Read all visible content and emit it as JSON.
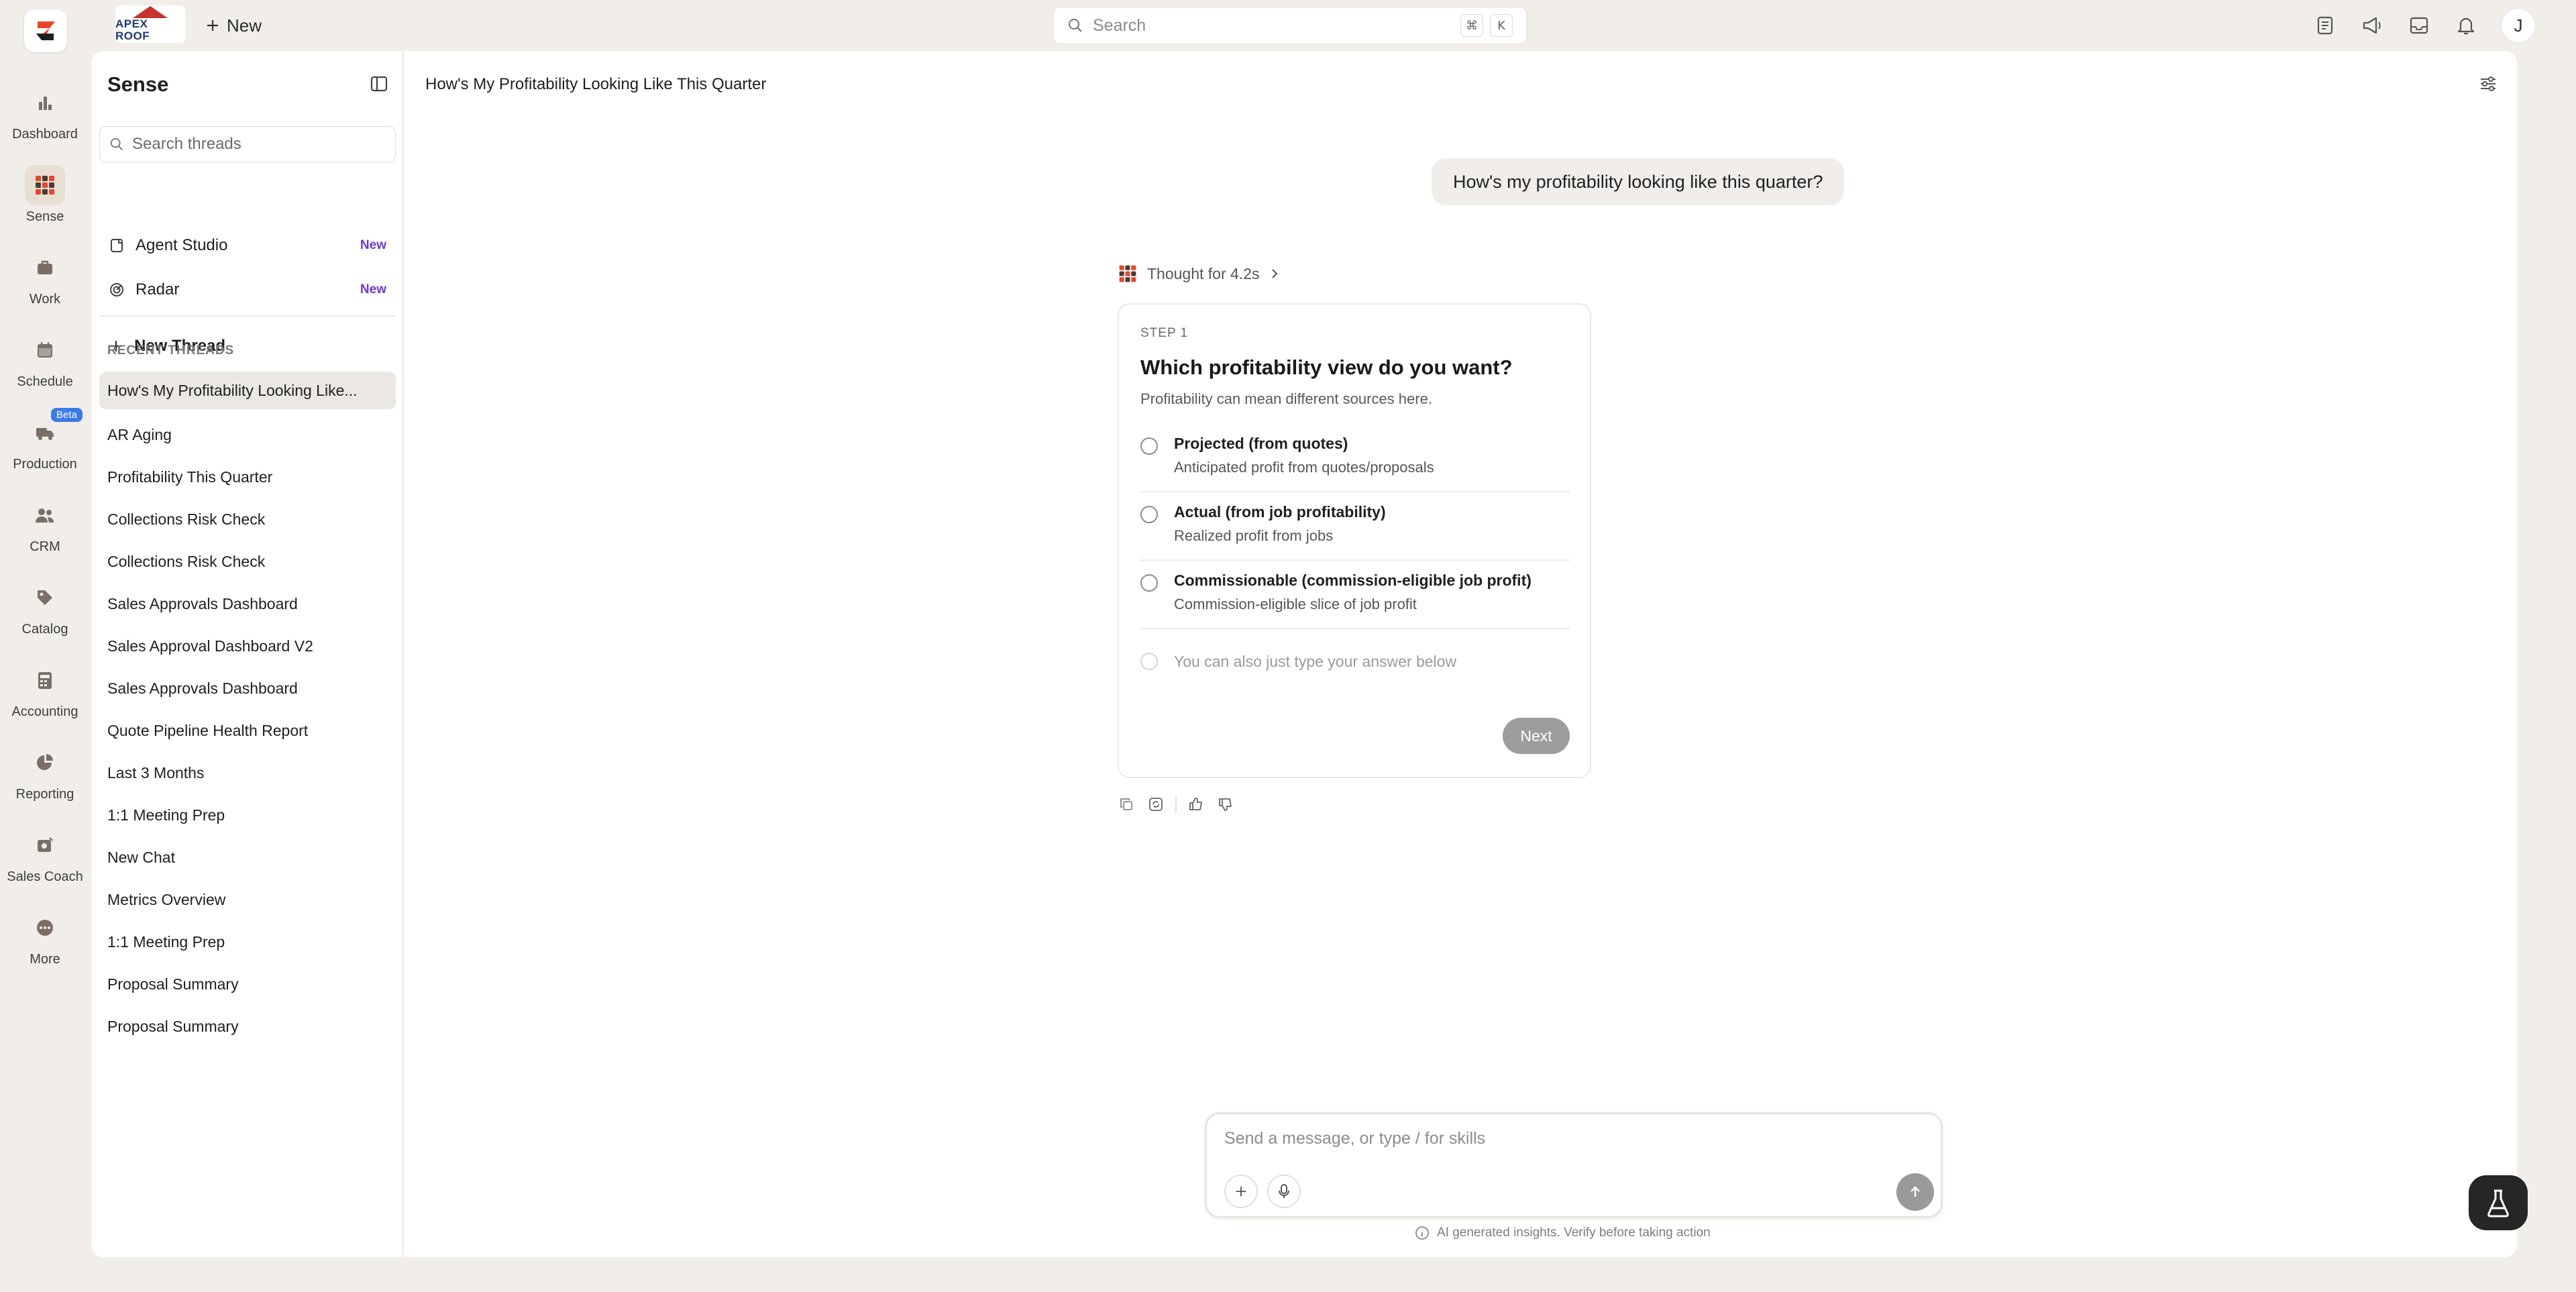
{
  "topbar": {
    "company_logo_text": "APEX ROOF",
    "new_label": "New",
    "search_placeholder": "Search",
    "search_shortcut": [
      "⌘",
      "K"
    ],
    "icons": [
      "notes-icon",
      "megaphone-icon",
      "inbox-icon",
      "bell-icon"
    ],
    "avatar_initial": "J"
  },
  "rail": [
    {
      "label": "Dashboard",
      "icon": "bar-chart-icon"
    },
    {
      "label": "Sense",
      "icon": "grid-icon",
      "active": true
    },
    {
      "label": "Work",
      "icon": "briefcase-icon"
    },
    {
      "label": "Schedule",
      "icon": "calendar-icon"
    },
    {
      "label": "Production",
      "icon": "truck-icon",
      "badge": "Beta"
    },
    {
      "label": "CRM",
      "icon": "users-icon"
    },
    {
      "label": "Catalog",
      "icon": "tag-icon"
    },
    {
      "label": "Accounting",
      "icon": "calculator-icon"
    },
    {
      "label": "Reporting",
      "icon": "pie-chart-icon"
    },
    {
      "label": "Sales Coach",
      "icon": "coach-icon"
    },
    {
      "label": "More",
      "icon": "more-icon"
    }
  ],
  "sidebar": {
    "title": "Sense",
    "search_placeholder": "Search threads",
    "links": [
      {
        "label": "Agent Studio",
        "tag": "New"
      },
      {
        "label": "Radar",
        "tag": "New"
      }
    ],
    "new_thread_label": "New Thread",
    "recent_label": "RECENT THREADS",
    "threads": [
      "How's My Profitability Looking Like...",
      "AR Aging",
      "Profitability This Quarter",
      "Collections Risk Check",
      "Collections Risk Check",
      "Sales Approvals Dashboard",
      "Sales Approval Dashboard V2",
      "Sales Approvals Dashboard",
      "Quote Pipeline Health Report",
      "Last 3 Months",
      "1:1 Meeting Prep",
      "New Chat",
      "Metrics Overview",
      "1:1 Meeting Prep",
      "Proposal Summary",
      "Proposal Summary"
    ]
  },
  "main": {
    "thread_title": "How's My Profitability Looking Like This Quarter",
    "user_message": "How's my profitability looking like this quarter?",
    "thought_label": "Thought for 4.2s",
    "card": {
      "step_label": "STEP 1",
      "question": "Which profitability view do you want?",
      "subtitle": "Profitability can mean different sources here.",
      "options": [
        {
          "title": "Projected (from quotes)",
          "desc": "Anticipated profit from quotes/proposals"
        },
        {
          "title": "Actual (from job profitability)",
          "desc": "Realized profit from jobs"
        },
        {
          "title": "Commissionable (commission-eligible job profit)",
          "desc": "Commission-eligible slice of job profit"
        }
      ],
      "free_text_hint": "You can also just type your answer below",
      "next_label": "Next"
    },
    "composer_placeholder": "Send a message, or type / for skills",
    "disclaimer": "AI generated insights. Verify before taking action"
  },
  "colors": {
    "background": "#f1eeea",
    "accent_red": "#e8452c",
    "new_tag": "#6b3ad6",
    "beta_badge": "#3a7be8"
  }
}
